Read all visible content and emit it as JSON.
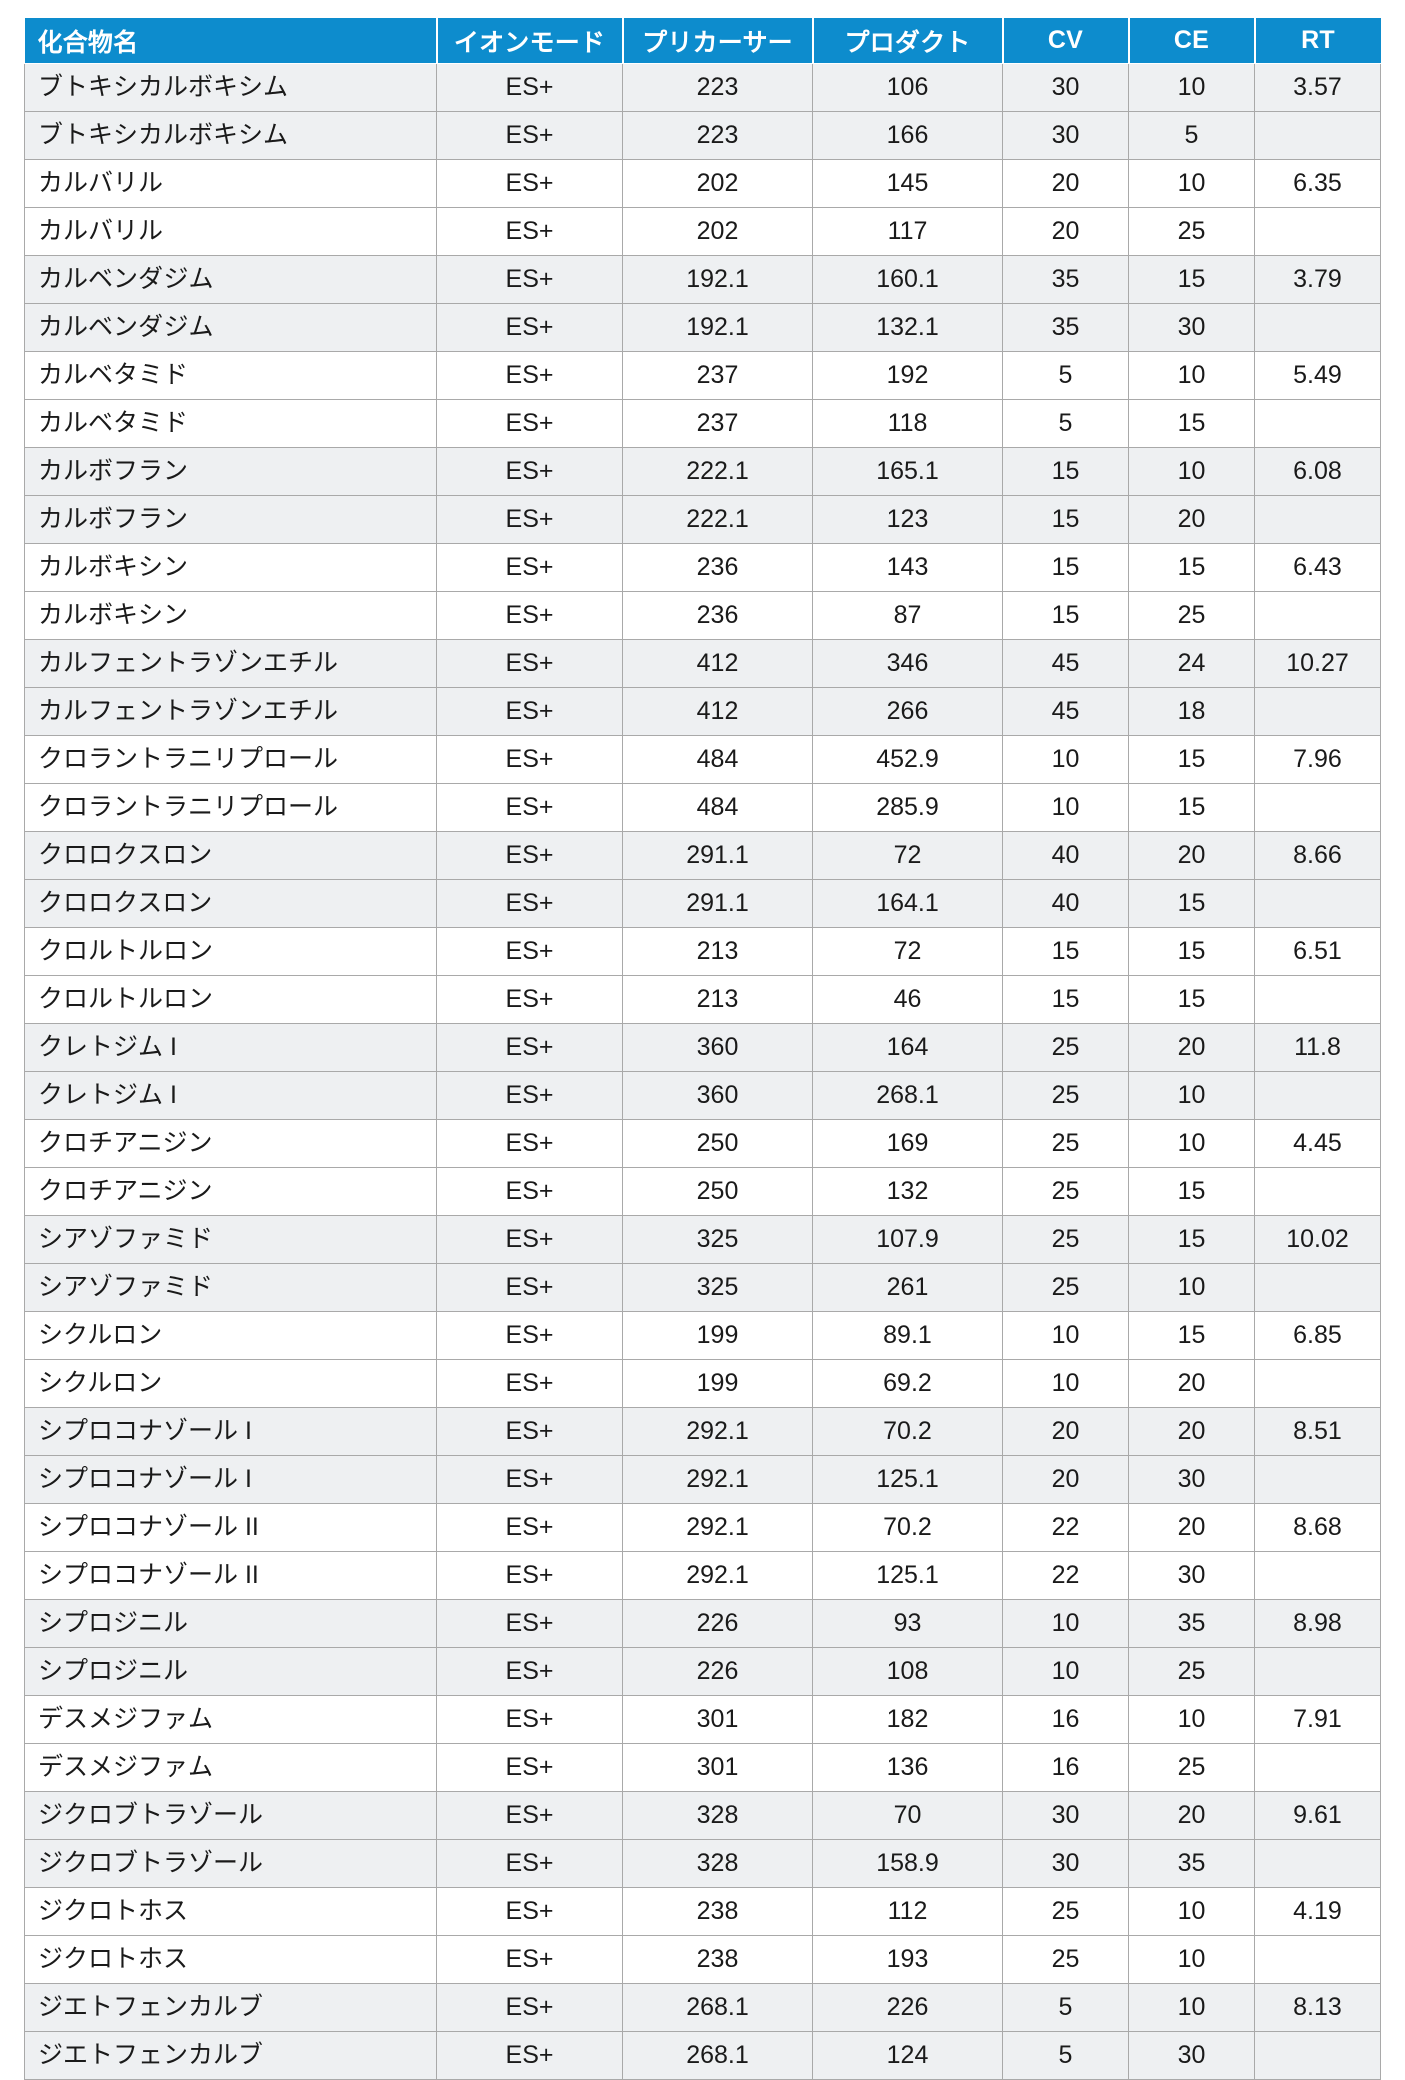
{
  "table": {
    "accent_color": "#0d8ccd",
    "header_text_color": "#ffffff",
    "grid_color": "#a9a9a9",
    "row_band_color": "#eef0f2",
    "columns": [
      {
        "key": "name",
        "label": "化合物名",
        "align": "left"
      },
      {
        "key": "ionmode",
        "label": "イオンモード",
        "align": "center"
      },
      {
        "key": "precursor",
        "label": "プリカーサー",
        "align": "center"
      },
      {
        "key": "product",
        "label": "プロダクト",
        "align": "center"
      },
      {
        "key": "cv",
        "label": "CV",
        "align": "center"
      },
      {
        "key": "ce",
        "label": "CE",
        "align": "center"
      },
      {
        "key": "rt",
        "label": "RT",
        "align": "center"
      }
    ],
    "rows": [
      {
        "name": "ブトキシカルボキシム",
        "ionmode": "ES+",
        "precursor": "223",
        "product": "106",
        "cv": "30",
        "ce": "10",
        "rt": "3.57"
      },
      {
        "name": "ブトキシカルボキシム",
        "ionmode": "ES+",
        "precursor": "223",
        "product": "166",
        "cv": "30",
        "ce": "5",
        "rt": ""
      },
      {
        "name": "カルバリル",
        "ionmode": "ES+",
        "precursor": "202",
        "product": "145",
        "cv": "20",
        "ce": "10",
        "rt": "6.35"
      },
      {
        "name": "カルバリル",
        "ionmode": "ES+",
        "precursor": "202",
        "product": "117",
        "cv": "20",
        "ce": "25",
        "rt": ""
      },
      {
        "name": "カルベンダジム",
        "ionmode": "ES+",
        "precursor": "192.1",
        "product": "160.1",
        "cv": "35",
        "ce": "15",
        "rt": "3.79"
      },
      {
        "name": "カルベンダジム",
        "ionmode": "ES+",
        "precursor": "192.1",
        "product": "132.1",
        "cv": "35",
        "ce": "30",
        "rt": ""
      },
      {
        "name": "カルベタミド",
        "ionmode": "ES+",
        "precursor": "237",
        "product": "192",
        "cv": "5",
        "ce": "10",
        "rt": "5.49"
      },
      {
        "name": "カルベタミド",
        "ionmode": "ES+",
        "precursor": "237",
        "product": "118",
        "cv": "5",
        "ce": "15",
        "rt": ""
      },
      {
        "name": "カルボフラン",
        "ionmode": "ES+",
        "precursor": "222.1",
        "product": "165.1",
        "cv": "15",
        "ce": "10",
        "rt": "6.08"
      },
      {
        "name": "カルボフラン",
        "ionmode": "ES+",
        "precursor": "222.1",
        "product": "123",
        "cv": "15",
        "ce": "20",
        "rt": ""
      },
      {
        "name": "カルボキシン",
        "ionmode": "ES+",
        "precursor": "236",
        "product": "143",
        "cv": "15",
        "ce": "15",
        "rt": "6.43"
      },
      {
        "name": "カルボキシン",
        "ionmode": "ES+",
        "precursor": "236",
        "product": "87",
        "cv": "15",
        "ce": "25",
        "rt": ""
      },
      {
        "name": "カルフェントラゾンエチル",
        "ionmode": "ES+",
        "precursor": "412",
        "product": "346",
        "cv": "45",
        "ce": "24",
        "rt": "10.27"
      },
      {
        "name": "カルフェントラゾンエチル",
        "ionmode": "ES+",
        "precursor": "412",
        "product": "266",
        "cv": "45",
        "ce": "18",
        "rt": ""
      },
      {
        "name": "クロラントラニリプロール",
        "ionmode": "ES+",
        "precursor": "484",
        "product": "452.9",
        "cv": "10",
        "ce": "15",
        "rt": "7.96"
      },
      {
        "name": "クロラントラニリプロール",
        "ionmode": "ES+",
        "precursor": "484",
        "product": "285.9",
        "cv": "10",
        "ce": "15",
        "rt": ""
      },
      {
        "name": "クロロクスロン",
        "ionmode": "ES+",
        "precursor": "291.1",
        "product": "72",
        "cv": "40",
        "ce": "20",
        "rt": "8.66"
      },
      {
        "name": "クロロクスロン",
        "ionmode": "ES+",
        "precursor": "291.1",
        "product": "164.1",
        "cv": "40",
        "ce": "15",
        "rt": ""
      },
      {
        "name": "クロルトルロン",
        "ionmode": "ES+",
        "precursor": "213",
        "product": "72",
        "cv": "15",
        "ce": "15",
        "rt": "6.51"
      },
      {
        "name": "クロルトルロン",
        "ionmode": "ES+",
        "precursor": "213",
        "product": "46",
        "cv": "15",
        "ce": "15",
        "rt": ""
      },
      {
        "name": "クレトジム I",
        "ionmode": "ES+",
        "precursor": "360",
        "product": "164",
        "cv": "25",
        "ce": "20",
        "rt": "11.8"
      },
      {
        "name": "クレトジム I",
        "ionmode": "ES+",
        "precursor": "360",
        "product": "268.1",
        "cv": "25",
        "ce": "10",
        "rt": ""
      },
      {
        "name": "クロチアニジン",
        "ionmode": "ES+",
        "precursor": "250",
        "product": "169",
        "cv": "25",
        "ce": "10",
        "rt": "4.45"
      },
      {
        "name": "クロチアニジン",
        "ionmode": "ES+",
        "precursor": "250",
        "product": "132",
        "cv": "25",
        "ce": "15",
        "rt": ""
      },
      {
        "name": "シアゾファミド",
        "ionmode": "ES+",
        "precursor": "325",
        "product": "107.9",
        "cv": "25",
        "ce": "15",
        "rt": "10.02"
      },
      {
        "name": "シアゾファミド",
        "ionmode": "ES+",
        "precursor": "325",
        "product": "261",
        "cv": "25",
        "ce": "10",
        "rt": ""
      },
      {
        "name": "シクルロン",
        "ionmode": "ES+",
        "precursor": "199",
        "product": "89.1",
        "cv": "10",
        "ce": "15",
        "rt": "6.85"
      },
      {
        "name": "シクルロン",
        "ionmode": "ES+",
        "precursor": "199",
        "product": "69.2",
        "cv": "10",
        "ce": "20",
        "rt": ""
      },
      {
        "name": "シプロコナゾール I",
        "ionmode": "ES+",
        "precursor": "292.1",
        "product": "70.2",
        "cv": "20",
        "ce": "20",
        "rt": "8.51"
      },
      {
        "name": "シプロコナゾール I",
        "ionmode": "ES+",
        "precursor": "292.1",
        "product": "125.1",
        "cv": "20",
        "ce": "30",
        "rt": ""
      },
      {
        "name": "シプロコナゾール II",
        "ionmode": "ES+",
        "precursor": "292.1",
        "product": "70.2",
        "cv": "22",
        "ce": "20",
        "rt": "8.68"
      },
      {
        "name": "シプロコナゾール II",
        "ionmode": "ES+",
        "precursor": "292.1",
        "product": "125.1",
        "cv": "22",
        "ce": "30",
        "rt": ""
      },
      {
        "name": "シプロジニル",
        "ionmode": "ES+",
        "precursor": "226",
        "product": "93",
        "cv": "10",
        "ce": "35",
        "rt": "8.98"
      },
      {
        "name": "シプロジニル",
        "ionmode": "ES+",
        "precursor": "226",
        "product": "108",
        "cv": "10",
        "ce": "25",
        "rt": ""
      },
      {
        "name": "デスメジファム",
        "ionmode": "ES+",
        "precursor": "301",
        "product": "182",
        "cv": "16",
        "ce": "10",
        "rt": "7.91"
      },
      {
        "name": "デスメジファム",
        "ionmode": "ES+",
        "precursor": "301",
        "product": "136",
        "cv": "16",
        "ce": "25",
        "rt": ""
      },
      {
        "name": "ジクロブトラゾール",
        "ionmode": "ES+",
        "precursor": "328",
        "product": "70",
        "cv": "30",
        "ce": "20",
        "rt": "9.61"
      },
      {
        "name": "ジクロブトラゾール",
        "ionmode": "ES+",
        "precursor": "328",
        "product": "158.9",
        "cv": "30",
        "ce": "35",
        "rt": ""
      },
      {
        "name": "ジクロトホス",
        "ionmode": "ES+",
        "precursor": "238",
        "product": "112",
        "cv": "25",
        "ce": "10",
        "rt": "4.19"
      },
      {
        "name": "ジクロトホス",
        "ionmode": "ES+",
        "precursor": "238",
        "product": "193",
        "cv": "25",
        "ce": "10",
        "rt": ""
      },
      {
        "name": "ジエトフェンカルブ",
        "ionmode": "ES+",
        "precursor": "268.1",
        "product": "226",
        "cv": "5",
        "ce": "10",
        "rt": "8.13"
      },
      {
        "name": "ジエトフェンカルブ",
        "ionmode": "ES+",
        "precursor": "268.1",
        "product": "124",
        "cv": "5",
        "ce": "30",
        "rt": ""
      }
    ]
  }
}
